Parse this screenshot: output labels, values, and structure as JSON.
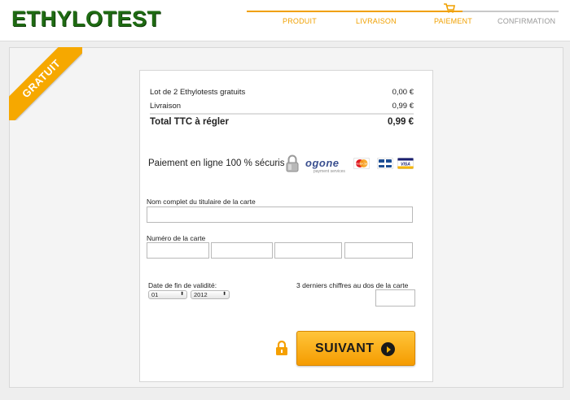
{
  "brand": {
    "logo": "ETHYLOTEST",
    "color": "#1f6b13"
  },
  "steps": {
    "items": [
      {
        "label": "PRODUIT",
        "state": "done"
      },
      {
        "label": "LIVRAISON",
        "state": "done"
      },
      {
        "label": "PAIEMENT",
        "state": "current"
      },
      {
        "label": "CONFIRMATION",
        "state": "todo"
      }
    ],
    "accent_color": "#f0a000",
    "current_icon": "cart-icon"
  },
  "ribbon": {
    "label": "GRATUIT",
    "color": "#f6a800"
  },
  "summary": {
    "rows": [
      {
        "label": "Lot de 2 Ethylotests gratuits",
        "value": "0,00 €"
      },
      {
        "label": "Livraison",
        "value": "0,99 €"
      }
    ],
    "total": {
      "label": "Total TTC à régler",
      "value": "0,99 €"
    }
  },
  "payment": {
    "secure_text": "Paiement en ligne 100 % sécuris",
    "provider_name": "ogone",
    "provider_tagline": "payment services",
    "icons": [
      "padlock-icon",
      "mastercard-icon",
      "cb-card-icon",
      "visa-icon"
    ],
    "card_brand_labels": {
      "mastercard": "MasterCard",
      "visa": "VISA"
    }
  },
  "form": {
    "cardholder_label": "Nom complet du titulaire de la carte",
    "cardholder_value": "",
    "card_number_label": "Numéro de la carte",
    "card_number_groups": [
      "",
      "",
      "",
      ""
    ],
    "expiry_label": "Date de fin de validité:",
    "expiry_month": "01",
    "expiry_year": "2012",
    "cvv_label": "3 derniers chiffres au dos de la carte",
    "cvv_value": ""
  },
  "actions": {
    "next_label": "SUIVANT",
    "lock_icon": "lock-icon",
    "button_color": "#f59c00"
  }
}
